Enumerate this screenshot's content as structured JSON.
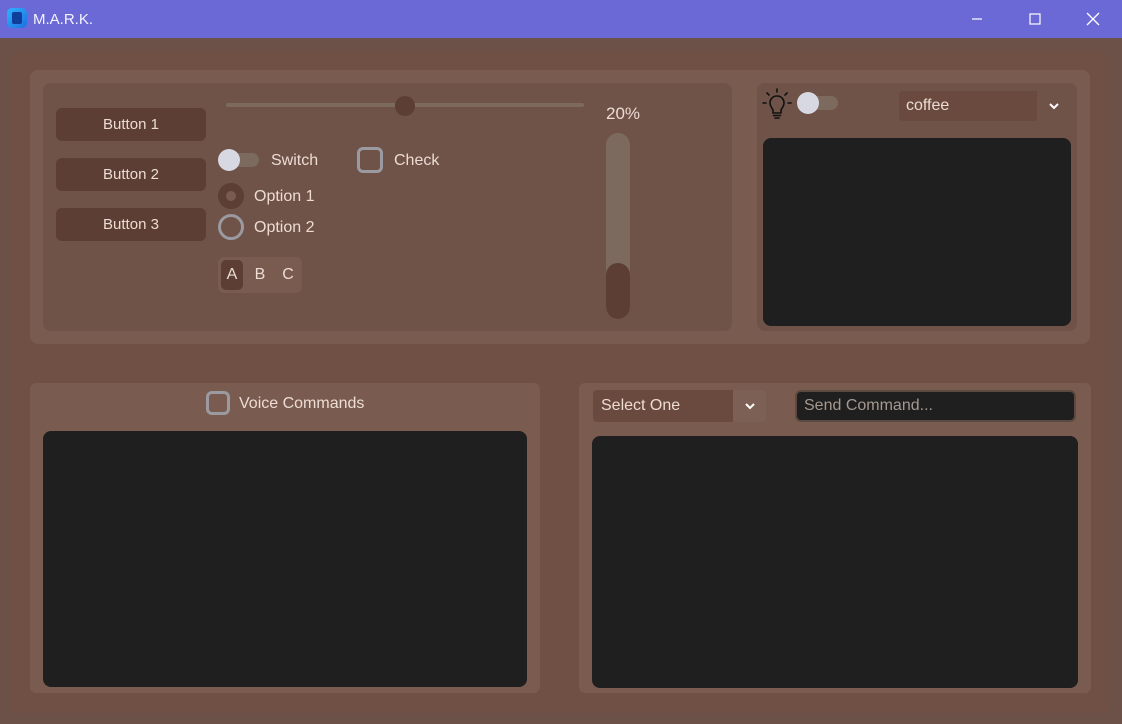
{
  "window": {
    "title": "M.A.R.K."
  },
  "controls": {
    "buttons": [
      "Button 1",
      "Button 2",
      "Button 3"
    ],
    "slider_value": 0.5,
    "switch_label": "Switch",
    "switch_on": false,
    "check_label": "Check",
    "check_checked": false,
    "radios": [
      "Option 1",
      "Option 2"
    ],
    "radio_selected": 0,
    "segments": [
      "A",
      "B",
      "C"
    ],
    "segment_selected": 0,
    "progress_percent": 20,
    "progress_label": "20%"
  },
  "theme_panel": {
    "icon": "lightbulb-icon",
    "switch_on": false,
    "theme_value": "coffee"
  },
  "voice_panel": {
    "checkbox_label": "Voice Commands",
    "checked": false
  },
  "command_panel": {
    "select_value": "Select One",
    "entry_placeholder": "Send Command..."
  },
  "colors": {
    "titlebar": "#6a69d6",
    "accent": "#5c3e34",
    "panel": "#7a5b50",
    "textbox": "#1e1f1e"
  }
}
